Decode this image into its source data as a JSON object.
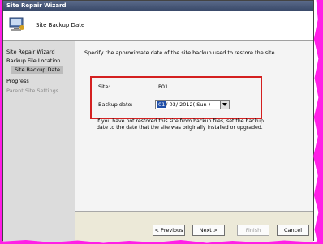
{
  "window": {
    "title": "Site Repair Wizard"
  },
  "header": {
    "title": "Site Backup Date",
    "icon": "computer-icon"
  },
  "nav": {
    "items": [
      {
        "label": "Site Repair Wizard",
        "state": "normal"
      },
      {
        "label": "Backup File Location",
        "state": "normal"
      },
      {
        "label": "Site Backup Date",
        "state": "selected"
      },
      {
        "label": "Progress",
        "state": "normal"
      },
      {
        "label": "Parent Site Settings",
        "state": "disabled"
      }
    ]
  },
  "content": {
    "instruction": "Specify the approximate date of the site backup used to restore the site.",
    "site_label": "Site:",
    "site_value": "P01",
    "backup_date_label": "Backup date:",
    "backup_date": {
      "selected_part": "01",
      "rest": "/ 03/ 2012( Sun )"
    },
    "note": "If you have not restored this site from backup files, set the backup date to the date that the site was originally installed or upgraded."
  },
  "buttons": {
    "previous": "< Previous",
    "next": "Next >",
    "finish": "Finish",
    "cancel": "Cancel"
  },
  "colors": {
    "highlight_border": "#d42020",
    "edge": "#ff1fe6",
    "selection": "#1f4ea8"
  }
}
